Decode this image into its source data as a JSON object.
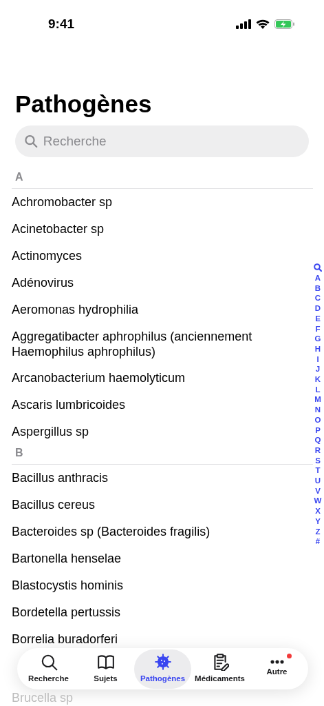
{
  "status_bar": {
    "time": "9:41"
  },
  "title": "Pathogènes",
  "search": {
    "placeholder": "Recherche"
  },
  "sections": [
    {
      "header": "A",
      "items": [
        "Achromobacter sp",
        "Acinetobacter sp",
        "Actinomyces",
        "Adénovirus",
        "Aeromonas hydrophilia",
        "Aggregatibacter aphrophilus (anciennement Haemophilus aphrophilus)",
        "Arcanobacterium haemolyticum",
        "Ascaris lumbricoides",
        "Aspergillus sp"
      ]
    },
    {
      "header": "B",
      "items": [
        "Bacillus anthracis",
        "Bacillus cereus",
        "Bacteroides sp (Bacteroides fragilis)",
        "Bartonella henselae",
        "Blastocystis hominis",
        "Bordetella pertussis",
        "Borrelia buradorferi"
      ]
    }
  ],
  "item_below_tab_bar": "Brucella sp",
  "index": [
    "A",
    "B",
    "C",
    "D",
    "E",
    "F",
    "G",
    "H",
    "I",
    "J",
    "K",
    "L",
    "M",
    "N",
    "O",
    "P",
    "Q",
    "R",
    "S",
    "T",
    "U",
    "V",
    "W",
    "X",
    "Y",
    "Z",
    "#"
  ],
  "tabs": [
    {
      "label": "Recherche",
      "kind": "search",
      "selected": false,
      "badge": false
    },
    {
      "label": "Sujets",
      "kind": "book",
      "selected": false,
      "badge": false
    },
    {
      "label": "Pathogènes",
      "kind": "virus",
      "selected": true,
      "badge": false
    },
    {
      "label": "Médicaments",
      "kind": "clipboard",
      "selected": false,
      "badge": false
    },
    {
      "label": "Autre",
      "kind": "more",
      "selected": false,
      "badge": true
    }
  ]
}
